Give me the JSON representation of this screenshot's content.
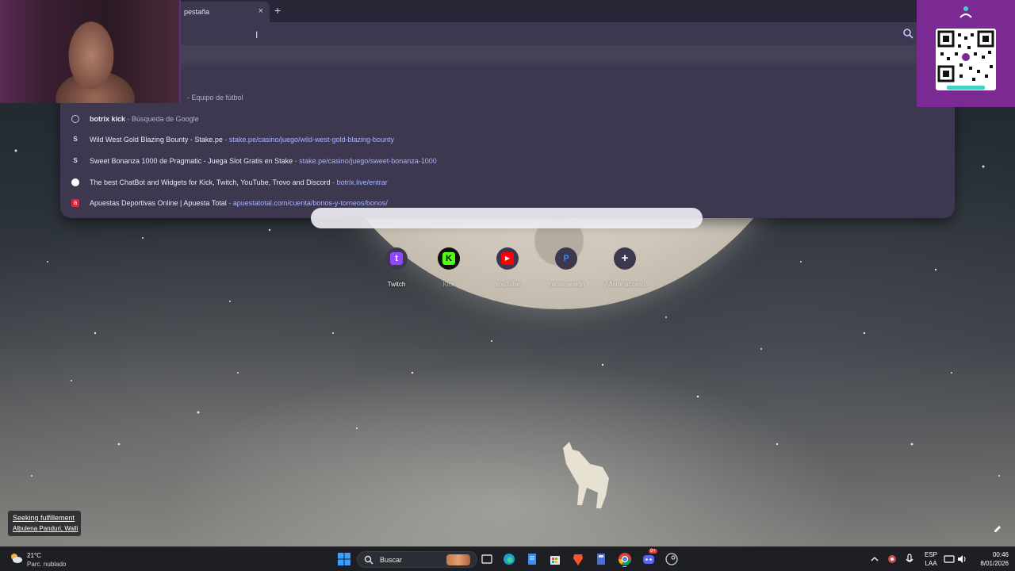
{
  "browser": {
    "tab": {
      "title": "pestaña",
      "close_glyph": "×"
    },
    "new_tab_glyph": "+",
    "suggestions": [
      {
        "icon": "soccer-result-icon",
        "title": "",
        "separator": "- ",
        "detail": "Equipo de fútbol",
        "url": ""
      },
      {
        "icon": "history-icon",
        "title_bold": "botrix kick",
        "separator": " - ",
        "detail": "Búsqueda de Google",
        "url": ""
      },
      {
        "icon": "stake-icon",
        "title": "Wild West Gold Blazing Bounty - Stake.pe",
        "separator": " - ",
        "detail": "",
        "url": "stake.pe/casino/juego/wild-west-gold-blazing-bounty"
      },
      {
        "icon": "stake-icon",
        "title": "Sweet Bonanza 1000 de Pragmatic - Juega Slot Gratis en Stake",
        "separator": " - ",
        "detail": "",
        "url": "stake.pe/casino/juego/sweet-bonanza-1000"
      },
      {
        "icon": "botrix-icon",
        "title": "The best ChatBot and Widgets for Kick, Twitch, YouTube, Trovo and Discord",
        "separator": " - ",
        "detail": "",
        "url": "botrix.live/entrar"
      },
      {
        "icon": "apuesta-total-icon",
        "title": "Apuestas Deportivas Online | Apuesta Total",
        "separator": " - ",
        "detail": "",
        "url": "apuestatotal.com/cuenta/bonos-y-torneos/bonos/"
      }
    ]
  },
  "shortcuts": [
    {
      "label": "Twitch",
      "glyph": "t",
      "color": "#9146ff"
    },
    {
      "label": "Kick",
      "glyph": "K",
      "color": "#53fc18"
    },
    {
      "label": "YouTube",
      "glyph": "▶",
      "color": "#ff0000"
    },
    {
      "label": "Iniciar sesión",
      "glyph": "P",
      "color": "#0070e0"
    },
    {
      "label": "Añadir acceso",
      "glyph": "+",
      "color": "#3d3750"
    }
  ],
  "music_toast": {
    "title": "Seeking fulfillement",
    "artist": "Albulena Panduri, Walli"
  },
  "taskbar": {
    "weather": {
      "temp": "21°C",
      "condition": "Parc. nublado"
    },
    "search_label": "Buscar",
    "language": {
      "line1": "ESP",
      "line2": "LAA"
    },
    "clock": {
      "time": "00:46",
      "date": "8/01/2026"
    },
    "discord_badge": "9+"
  },
  "colors": {
    "accent": "#7b2a94",
    "omnibox_bg": "#3d3750",
    "link": "#a9b7ff"
  }
}
